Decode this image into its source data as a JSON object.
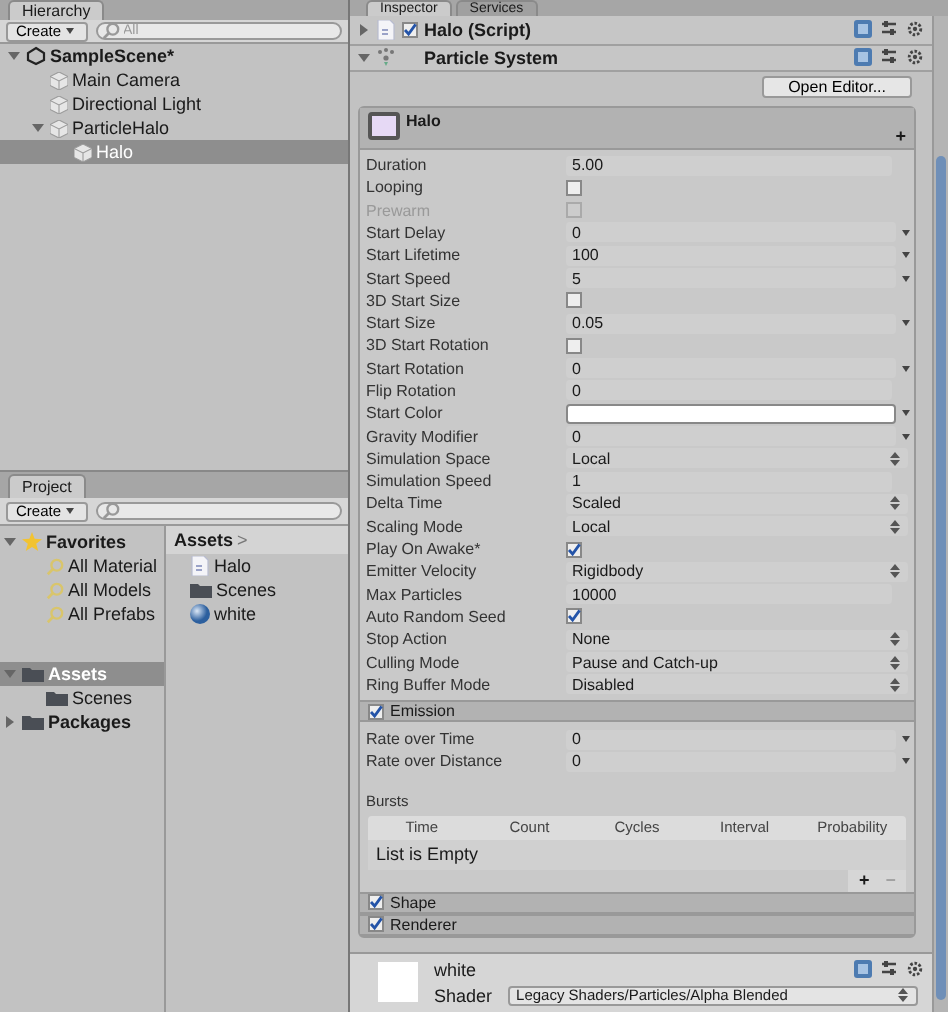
{
  "hierarchy": {
    "tab": "Hierarchy",
    "create": "Create",
    "search": {
      "placeholder": "All"
    },
    "tree": [
      {
        "label": "SampleScene*",
        "kind": "scene",
        "expanded": true,
        "selected": false,
        "children": [
          {
            "label": "Main Camera",
            "kind": "object",
            "selected": false
          },
          {
            "label": "Directional Light",
            "kind": "object",
            "selected": false
          },
          {
            "label": "ParticleHalo",
            "kind": "object",
            "expanded": true,
            "selected": false,
            "children": [
              {
                "label": "Halo",
                "kind": "object",
                "selected": true
              }
            ]
          }
        ]
      }
    ]
  },
  "project": {
    "tab": "Project",
    "create": "Create",
    "tree": [
      {
        "label": "Favorites",
        "kind": "favorites",
        "expanded": true,
        "selected": false,
        "children": [
          {
            "label": "All Material",
            "kind": "search",
            "selected": false
          },
          {
            "label": "All Models",
            "kind": "search",
            "selected": false
          },
          {
            "label": "All Prefabs",
            "kind": "search",
            "selected": false
          }
        ]
      },
      {
        "label": "Assets",
        "kind": "folder",
        "expanded": true,
        "selected": true,
        "children": [
          {
            "label": "Scenes",
            "kind": "folder",
            "selected": false
          }
        ]
      },
      {
        "label": "Packages",
        "kind": "folder",
        "expanded": false,
        "selected": false
      }
    ],
    "breadcrumb": "Assets",
    "breadcrumb_arrow": ">",
    "files": [
      {
        "label": "Halo",
        "kind": "script"
      },
      {
        "label": "Scenes",
        "kind": "folder"
      },
      {
        "label": "white",
        "kind": "material"
      }
    ]
  },
  "inspector": {
    "tabs": [
      {
        "label": "Inspector",
        "selected": true
      },
      {
        "label": "Services",
        "selected": false
      }
    ],
    "components": [
      {
        "title": "Halo (Script)",
        "kind": "script",
        "expanded": false,
        "enabled": true
      },
      {
        "title": "Particle System",
        "kind": "particles",
        "expanded": true
      }
    ],
    "open_editor": "Open Editor...",
    "main_module": {
      "title": "Halo",
      "color": "#e6d9f5",
      "plus": "+"
    },
    "properties": [
      {
        "label": "Duration",
        "kind": "text",
        "value": "5.00",
        "disabled": false
      },
      {
        "label": "Looping",
        "kind": "checkbox",
        "checked": false,
        "disabled": false
      },
      {
        "label": "Prewarm",
        "kind": "checkbox",
        "checked": false,
        "disabled": true
      },
      {
        "label": "Start Delay",
        "kind": "curve",
        "value": "0",
        "disabled": false
      },
      {
        "label": "Start Lifetime",
        "kind": "curve",
        "value": "100",
        "disabled": false
      },
      {
        "label": "Start Speed",
        "kind": "curve",
        "value": "5",
        "disabled": false
      },
      {
        "label": "3D Start Size",
        "kind": "checkbox",
        "checked": false,
        "disabled": false
      },
      {
        "label": "Start Size",
        "kind": "curve",
        "value": "0.05",
        "disabled": false
      },
      {
        "label": "3D Start Rotation",
        "kind": "checkbox",
        "checked": false,
        "disabled": false
      },
      {
        "label": "Start Rotation",
        "kind": "curve",
        "value": "0",
        "disabled": false
      },
      {
        "label": "Flip Rotation",
        "kind": "text",
        "value": "0",
        "disabled": false
      },
      {
        "label": "Start Color",
        "kind": "color",
        "color": "#ffffff",
        "disabled": false
      },
      {
        "label": "Gravity Modifier",
        "kind": "curve",
        "value": "0",
        "disabled": false
      },
      {
        "label": "Simulation Space",
        "kind": "dropdown",
        "value": "Local",
        "disabled": false
      },
      {
        "label": "Simulation Speed",
        "kind": "text",
        "value": "1",
        "disabled": false
      },
      {
        "label": "Delta Time",
        "kind": "dropdown",
        "value": "Scaled",
        "disabled": false
      },
      {
        "label": "Scaling Mode",
        "kind": "dropdown",
        "value": "Local",
        "disabled": false
      },
      {
        "label": "Play On Awake*",
        "kind": "checkbox",
        "checked": true,
        "disabled": false
      },
      {
        "label": "Emitter Velocity",
        "kind": "dropdown",
        "value": "Rigidbody",
        "disabled": false
      },
      {
        "label": "Max Particles",
        "kind": "text",
        "value": "10000",
        "disabled": false
      },
      {
        "label": "Auto Random Seed",
        "kind": "checkbox",
        "checked": true,
        "disabled": false
      },
      {
        "label": "Stop Action",
        "kind": "dropdown",
        "value": "None",
        "disabled": false
      },
      {
        "label": "Culling Mode",
        "kind": "dropdown",
        "value": "Pause and Catch-up",
        "disabled": false
      },
      {
        "label": "Ring Buffer Mode",
        "kind": "dropdown",
        "value": "Disabled",
        "disabled": false
      }
    ],
    "emission": {
      "title": "Emission",
      "enabled": true,
      "rows": [
        {
          "label": "Rate over Time",
          "value": "0"
        },
        {
          "label": "Rate over Distance",
          "value": "0"
        }
      ],
      "bursts": {
        "label": "Bursts",
        "columns": [
          "Time",
          "Count",
          "Cycles",
          "Interval",
          "Probability"
        ],
        "empty": "List is Empty",
        "add": "+",
        "remove": "−"
      }
    },
    "modules": [
      {
        "title": "Shape",
        "enabled": true
      },
      {
        "title": "Renderer",
        "enabled": true
      }
    ],
    "material": {
      "name": "white",
      "shader_label": "Shader",
      "shader": "Legacy Shaders/Particles/Alpha Blended"
    }
  }
}
